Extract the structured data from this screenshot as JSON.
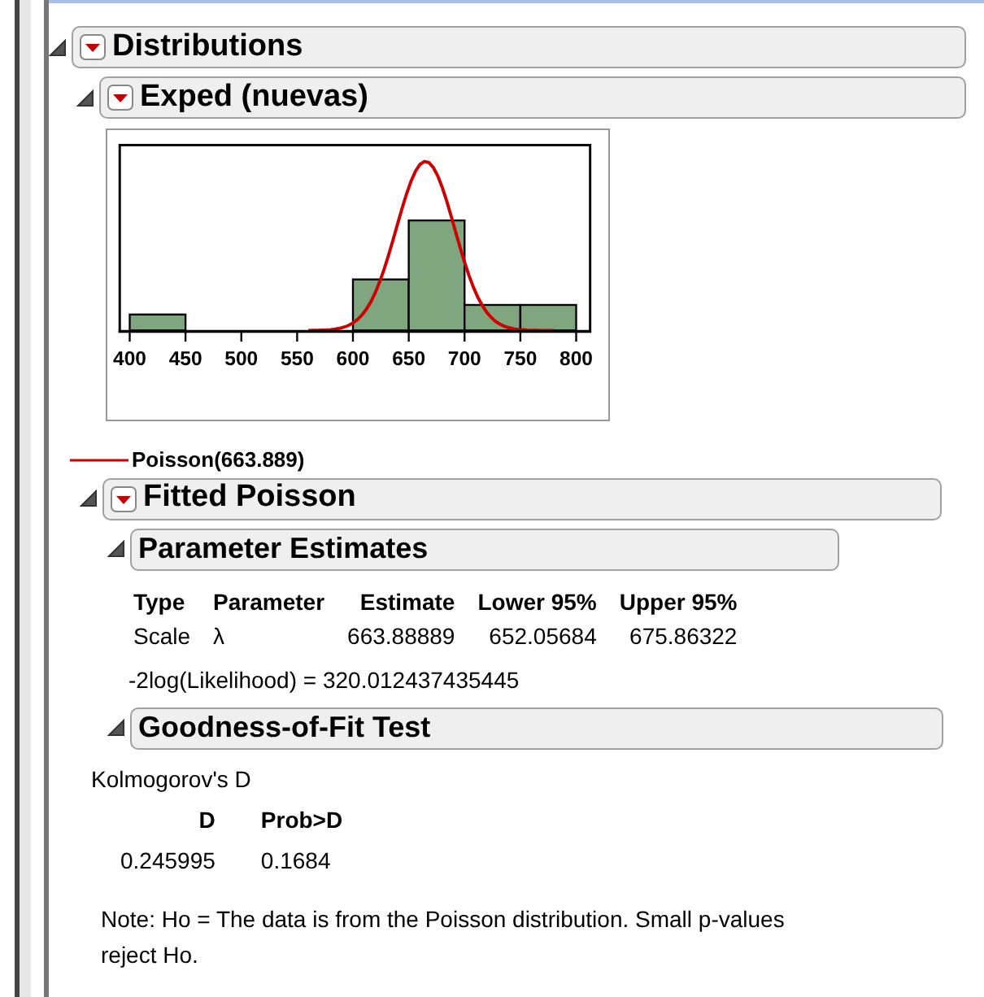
{
  "report": {
    "title": "Distributions",
    "expanded": true,
    "menu": true
  },
  "variable": {
    "title": "Exped (nuevas)",
    "expanded": true,
    "menu": true
  },
  "histogram": {
    "axis_labels": [
      "400",
      "450",
      "500",
      "550",
      "600",
      "650",
      "700",
      "750",
      "800"
    ]
  },
  "legend": {
    "label": "Poisson(663.889)",
    "color": "#cc0000"
  },
  "fit": {
    "title": "Fitted Poisson",
    "expanded": true,
    "menu": true
  },
  "parameter_estimates": {
    "title": "Parameter Estimates",
    "expanded": true,
    "menu": false,
    "columns": [
      "Type",
      "Parameter",
      "Estimate",
      "Lower 95%",
      "Upper 95%"
    ],
    "rows": [
      [
        "Scale",
        "λ",
        "663.88889",
        "652.05684",
        "675.86322"
      ]
    ],
    "likelihood": "-2log(Likelihood) = 320.012437435445"
  },
  "goodness_of_fit": {
    "title": "Goodness-of-Fit Test",
    "expanded": true,
    "menu": false,
    "test": "Kolmogorov's D",
    "columns": [
      "D",
      "Prob>D"
    ],
    "values": [
      "0.245995",
      "0.1684"
    ],
    "note": "Note: Ho = The data is from the Poisson distribution. Small p-values reject Ho."
  }
}
